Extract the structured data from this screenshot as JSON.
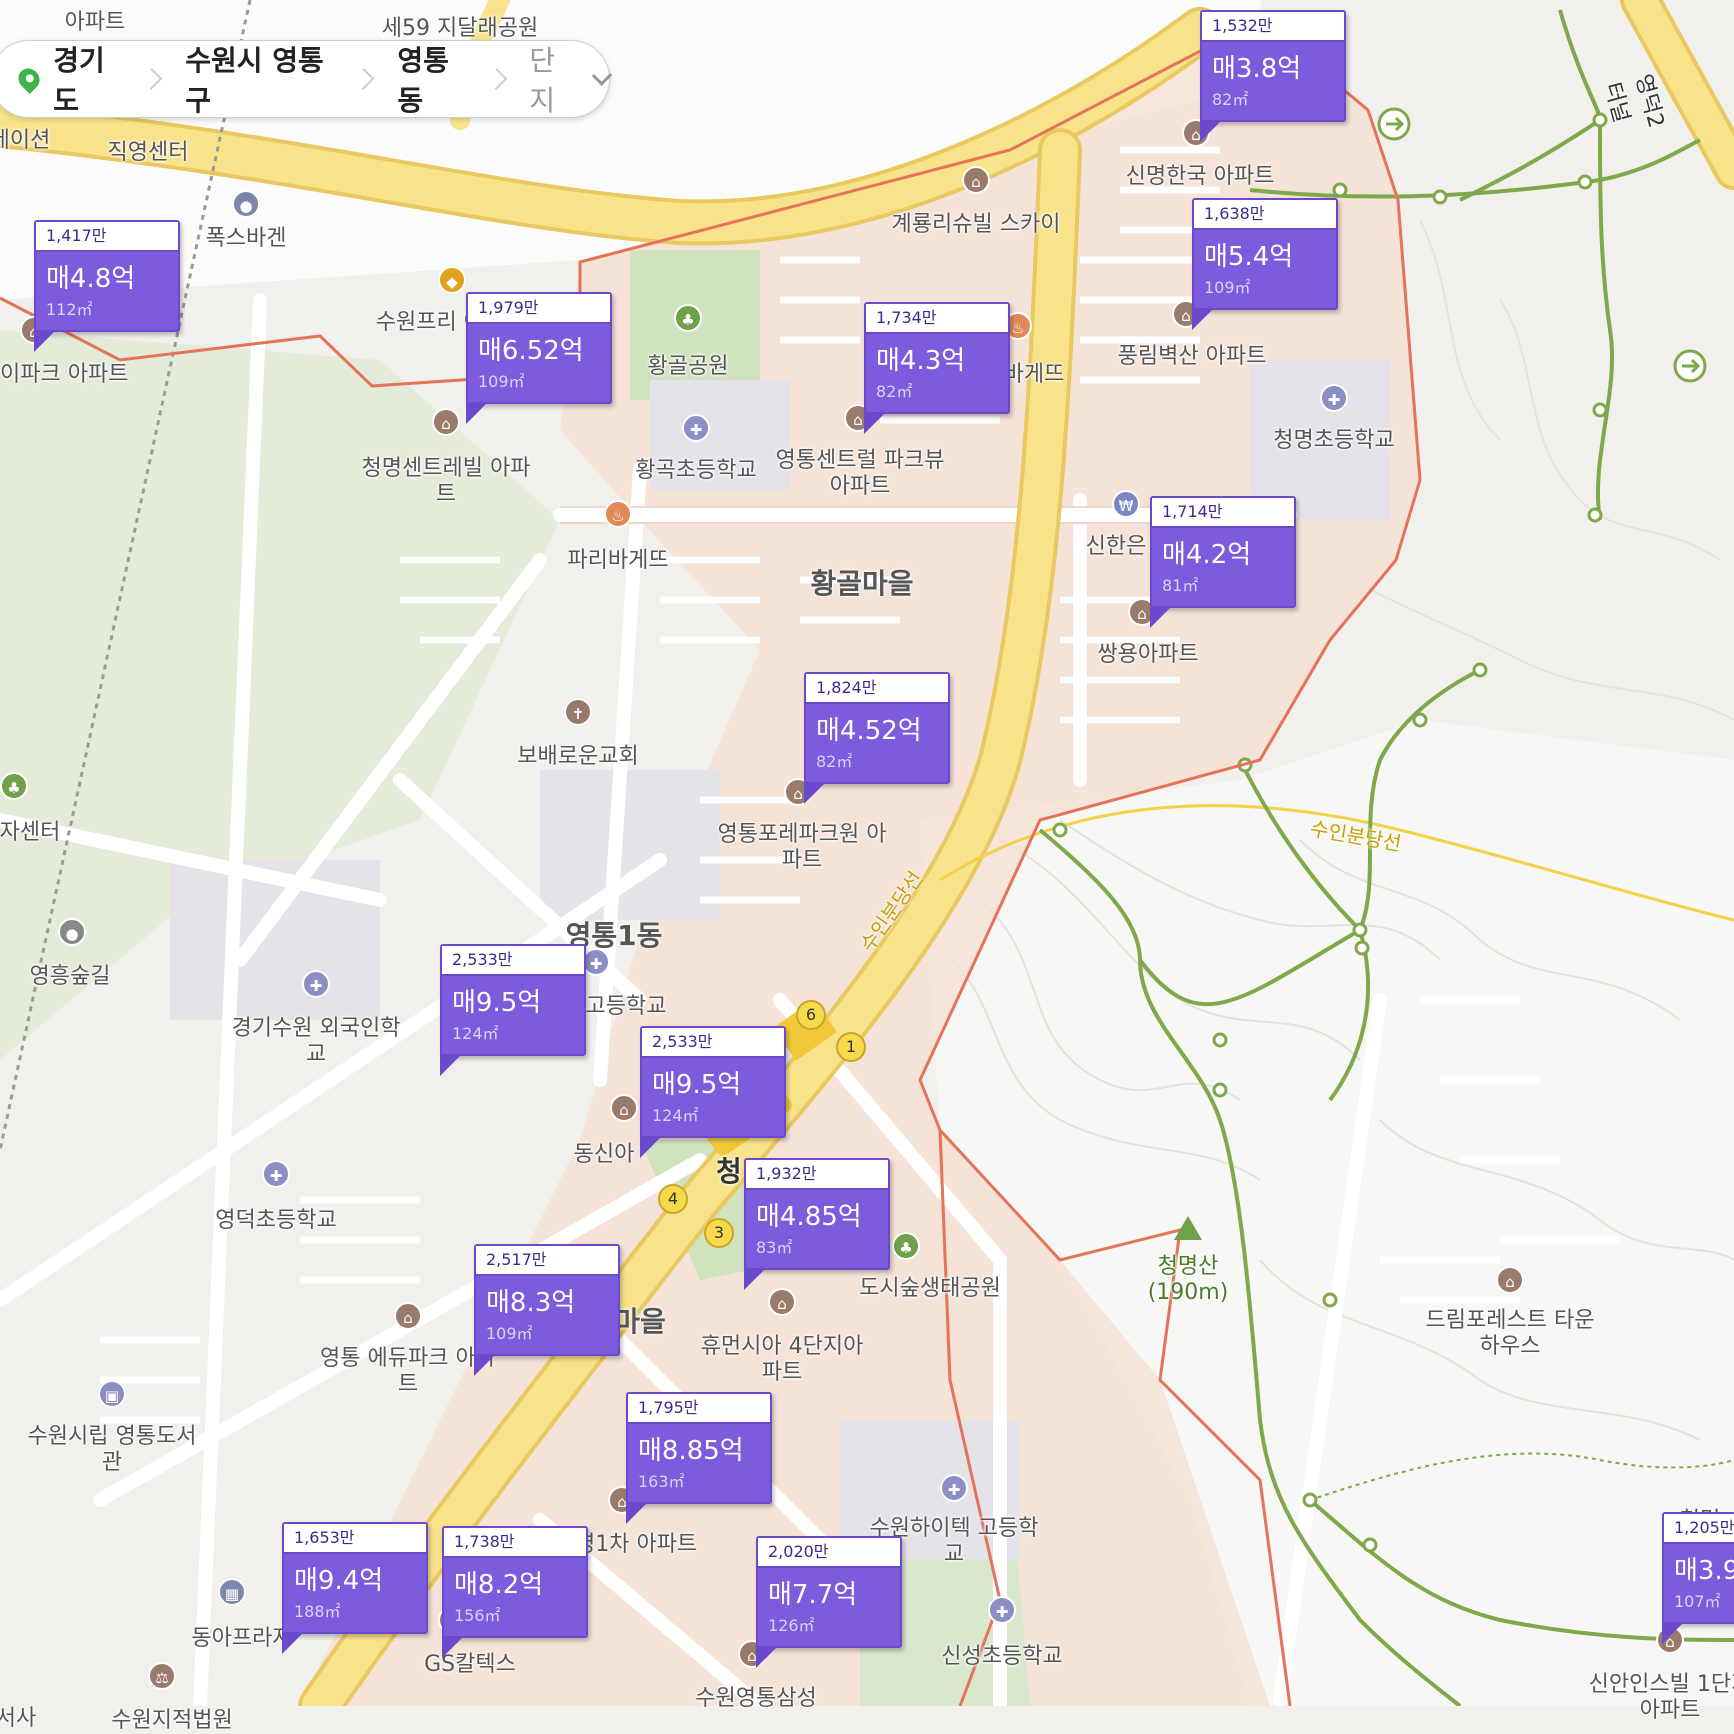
{
  "breadcrumb": {
    "province": "경기도",
    "city": "수원시 영통구",
    "dong": "영통동",
    "mode": "단지"
  },
  "colors": {
    "marker": "#7c5cdc",
    "boundary": "#e4735a",
    "road_main": "#f4d872",
    "park": "#cfe3bf",
    "district_fill": "#f6dfd2",
    "trail": "#7fa84a"
  },
  "area_labels": {
    "hwanggol": "황골마을",
    "yeongtong1": "영통1동",
    "maeul": "마을"
  },
  "line_labels": {
    "suin_bundang": "수인분당선",
    "suin_bundang_2": "수인분당선",
    "yeongdeok_tunnel": "영덕2터널"
  },
  "peak": {
    "name": "청명산",
    "height": "(190m)"
  },
  "station": {
    "name": "청",
    "exits": [
      "6",
      "1",
      "4",
      "3"
    ]
  },
  "pois": [
    {
      "name": "아파트",
      "icon": "apartment-icon"
    },
    {
      "name": "세59 지달래공원",
      "icon": "park-icon"
    },
    {
      "name": "테이션",
      "icon": "none"
    },
    {
      "name": "직영센터",
      "icon": "none"
    },
    {
      "name": "폭스바겐",
      "icon": "car-icon"
    },
    {
      "name": "수원프리 아울",
      "icon": "shopping-icon"
    },
    {
      "name": "통아이파크 아파트",
      "icon": "apartment-icon"
    },
    {
      "name": "황골공원",
      "icon": "park-icon"
    },
    {
      "name": "계룡리슈빌 스카이",
      "icon": "apartment-icon"
    },
    {
      "name": "신명한국 아파트",
      "icon": "apartment-icon"
    },
    {
      "name": "풍림벽산 아파트",
      "icon": "apartment-icon"
    },
    {
      "name": "청명초등학교",
      "icon": "school-icon"
    },
    {
      "name": "청명센트레빌 아파트",
      "icon": "apartment-icon"
    },
    {
      "name": "황곡초등학교",
      "icon": "school-icon"
    },
    {
      "name": "영통센트럴 파크뷰아파트",
      "icon": "apartment-icon"
    },
    {
      "name": "바게뜨",
      "icon": "bakery-icon"
    },
    {
      "name": "파리바게뜨",
      "icon": "bakery-icon"
    },
    {
      "name": "신한은",
      "icon": "bank-icon"
    },
    {
      "name": "쌍용아파트",
      "icon": "apartment-icon"
    },
    {
      "name": "보배로운교회",
      "icon": "church-icon"
    },
    {
      "name": "자센터",
      "icon": "park-icon"
    },
    {
      "name": "영통포레파크원 아파트",
      "icon": "apartment-icon"
    },
    {
      "name": "영흥숲길",
      "icon": "place-icon"
    },
    {
      "name": "경기수원 외국인학교",
      "icon": "school-icon"
    },
    {
      "name": "고등학교",
      "icon": "school-icon"
    },
    {
      "name": "동신아",
      "icon": "apartment-icon"
    },
    {
      "name": "영덕초등학교",
      "icon": "school-icon"
    },
    {
      "name": "도시숲생태공원",
      "icon": "park-icon"
    },
    {
      "name": "휴먼시아 4단지아파트",
      "icon": "apartment-icon"
    },
    {
      "name": "영통 에듀파크 아파트",
      "icon": "apartment-icon"
    },
    {
      "name": "수원시립 영통도서관",
      "icon": "library-icon"
    },
    {
      "name": "드림포레스트 타운하우스",
      "icon": "apartment-icon"
    },
    {
      "name": "건영1차 아파트",
      "icon": "apartment-icon"
    },
    {
      "name": "수원하이텍 고등학교",
      "icon": "school-icon"
    },
    {
      "name": "동아프라자",
      "icon": "building-icon"
    },
    {
      "name": "GS칼텍스",
      "icon": "gas-icon"
    },
    {
      "name": "신성초등학교",
      "icon": "school-icon"
    },
    {
      "name": "수원영통삼성",
      "icon": "apartment-icon"
    },
    {
      "name": "신안인스빌 1단지아파트",
      "icon": "apartment-icon"
    },
    {
      "name": "청명",
      "icon": "none"
    },
    {
      "name": "수원지적법원",
      "icon": "court-icon"
    },
    {
      "name": "서사",
      "icon": "none"
    }
  ],
  "price_markers": [
    {
      "unit": "1,417만",
      "price": "매4.8억",
      "size": "112㎡"
    },
    {
      "unit": "1,979만",
      "price": "매6.52억",
      "size": "109㎡"
    },
    {
      "unit": "1,532만",
      "price": "매3.8억",
      "size": "82㎡"
    },
    {
      "unit": "1,638만",
      "price": "매5.4억",
      "size": "109㎡"
    },
    {
      "unit": "1,734만",
      "price": "매4.3억",
      "size": "82㎡"
    },
    {
      "unit": "1,714만",
      "price": "매4.2억",
      "size": "81㎡"
    },
    {
      "unit": "1,824만",
      "price": "매4.52억",
      "size": "82㎡"
    },
    {
      "unit": "2,533만",
      "price": "매9.5억",
      "size": "124㎡"
    },
    {
      "unit": "2,533만",
      "price": "매9.5억",
      "size": "124㎡"
    },
    {
      "unit": "1,932만",
      "price": "매4.85억",
      "size": "83㎡"
    },
    {
      "unit": "2,517만",
      "price": "매8.3억",
      "size": "109㎡"
    },
    {
      "unit": "1,795만",
      "price": "매8.85억",
      "size": "163㎡"
    },
    {
      "unit": "1,653만",
      "price": "매9.4억",
      "size": "188㎡"
    },
    {
      "unit": "1,738만",
      "price": "매8.2억",
      "size": "156㎡"
    },
    {
      "unit": "2,020만",
      "price": "매7.7억",
      "size": "126㎡"
    },
    {
      "unit": "1,205만",
      "price": "매3.9",
      "size": "107㎡"
    }
  ]
}
